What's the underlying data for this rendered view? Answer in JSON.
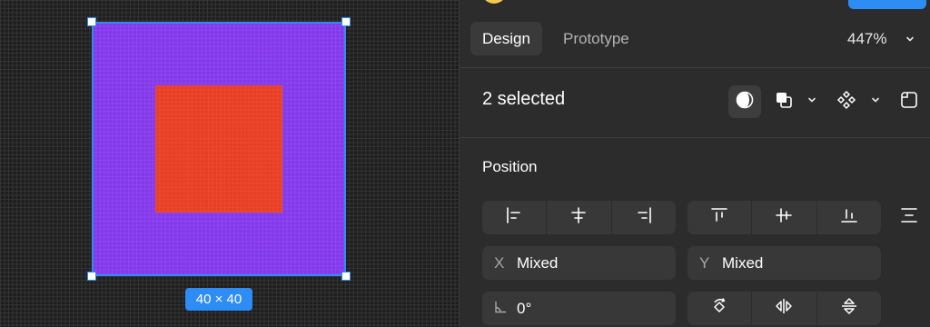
{
  "canvas": {
    "size_label": "40 × 40",
    "colors": {
      "frame": "#8338ec",
      "inner": "#e83f24",
      "selection": "#2e8cf5"
    }
  },
  "panel": {
    "tabs": [
      {
        "label": "Design",
        "active": true
      },
      {
        "label": "Prototype",
        "active": false
      }
    ],
    "zoom": "447%",
    "selection_title": "2 selected",
    "toolbar_icons": [
      "mask-icon",
      "boolean-union-icon",
      "chevron-down-icon",
      "component-icon",
      "chevron-down-icon",
      "frame-selection-icon"
    ],
    "position": {
      "title": "Position",
      "horizontal_align_icons": [
        "align-left-icon",
        "align-horizontal-center-icon",
        "align-right-icon"
      ],
      "vertical_align_icons": [
        "align-top-icon",
        "align-vertical-center-icon",
        "align-bottom-icon"
      ],
      "distribute_icon": "distribute-spacing-icon",
      "x": {
        "prefix": "X",
        "value": "Mixed"
      },
      "y": {
        "prefix": "Y",
        "value": "Mixed"
      },
      "rotation": {
        "value": "0°"
      },
      "transform_icons": [
        "rotate-icon",
        "flip-horizontal-icon",
        "flip-vertical-icon"
      ]
    }
  }
}
